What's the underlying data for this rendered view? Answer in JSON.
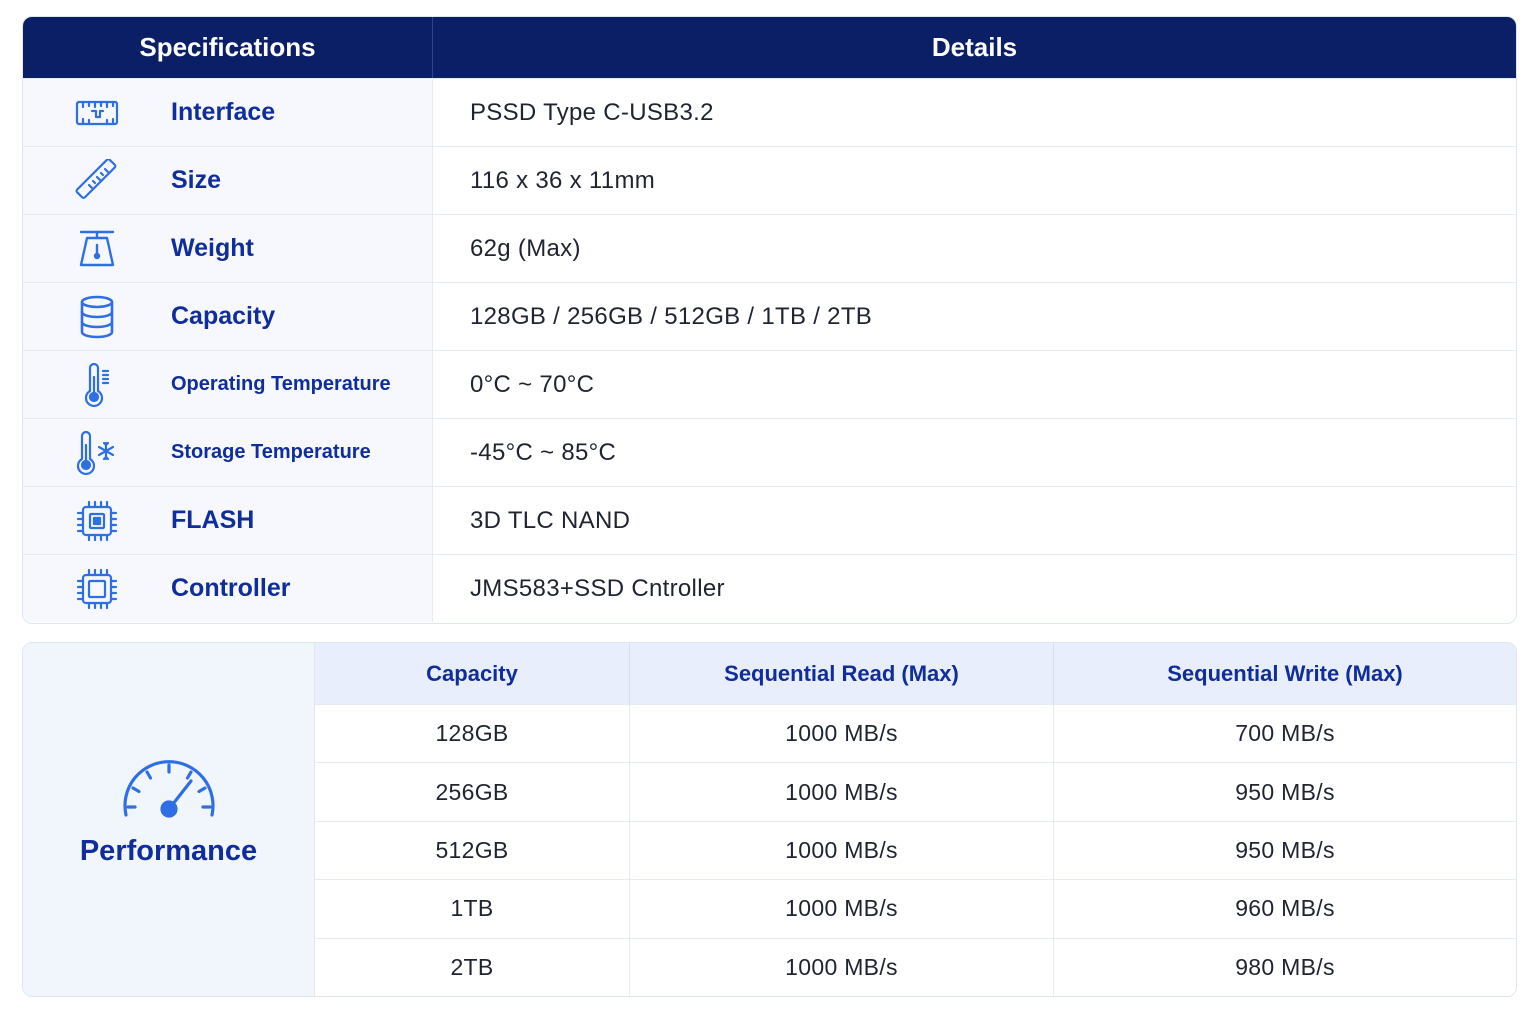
{
  "specifications": {
    "header": {
      "label_column": "Specifications",
      "value_column": "Details"
    },
    "rows": [
      {
        "icon": "interface-port-icon",
        "label": "Interface",
        "value": "PSSD Type C-USB3.2"
      },
      {
        "icon": "ruler-icon",
        "label": "Size",
        "value": "116 x 36 x 11mm"
      },
      {
        "icon": "scale-icon",
        "label": "Weight",
        "value": "62g (Max)"
      },
      {
        "icon": "database-icon",
        "label": "Capacity",
        "value": "128GB / 256GB / 512GB / 1TB / 2TB"
      },
      {
        "icon": "thermometer-icon",
        "label": "Operating Temperature",
        "value": "0°C ~ 70°C"
      },
      {
        "icon": "thermometer-snowflake-icon",
        "label": "Storage Temperature",
        "value": "-45°C ~ 85°C"
      },
      {
        "icon": "flash-chip-icon",
        "label": "FLASH",
        "value": "3D TLC NAND"
      },
      {
        "icon": "controller-chip-icon",
        "label": "Controller",
        "value": "JMS583+SSD Cntroller"
      }
    ]
  },
  "performance": {
    "title": "Performance",
    "icon": "speedometer-icon",
    "columns": [
      "Capacity",
      "Sequential Read (Max)",
      "Sequential Write (Max)"
    ],
    "rows": [
      [
        "128GB",
        "1000 MB/s",
        "700 MB/s"
      ],
      [
        "256GB",
        "1000 MB/s",
        "950 MB/s"
      ],
      [
        "512GB",
        "1000 MB/s",
        "950 MB/s"
      ],
      [
        "1TB",
        "1000 MB/s",
        "960 MB/s"
      ],
      [
        "2TB",
        "1000 MB/s",
        "980 MB/s"
      ]
    ]
  },
  "colors": {
    "header_bg": "#0b1f66",
    "accent_text": "#102e9b",
    "icon_blue": "#2f6fe4",
    "label_bg": "#f6f8fd"
  }
}
